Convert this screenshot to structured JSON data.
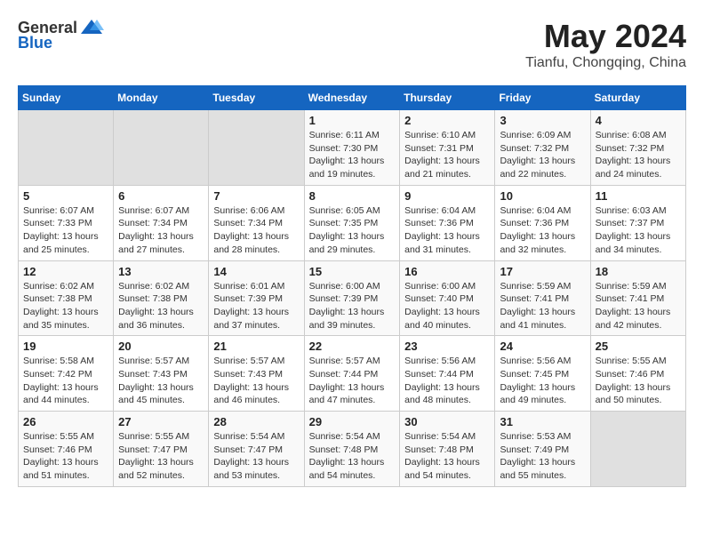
{
  "logo": {
    "general": "General",
    "blue": "Blue"
  },
  "title": "May 2024",
  "subtitle": "Tianfu, Chongqing, China",
  "headers": [
    "Sunday",
    "Monday",
    "Tuesday",
    "Wednesday",
    "Thursday",
    "Friday",
    "Saturday"
  ],
  "weeks": [
    [
      {
        "day": "",
        "info": ""
      },
      {
        "day": "",
        "info": ""
      },
      {
        "day": "",
        "info": ""
      },
      {
        "day": "1",
        "info": "Sunrise: 6:11 AM\nSunset: 7:30 PM\nDaylight: 13 hours\nand 19 minutes."
      },
      {
        "day": "2",
        "info": "Sunrise: 6:10 AM\nSunset: 7:31 PM\nDaylight: 13 hours\nand 21 minutes."
      },
      {
        "day": "3",
        "info": "Sunrise: 6:09 AM\nSunset: 7:32 PM\nDaylight: 13 hours\nand 22 minutes."
      },
      {
        "day": "4",
        "info": "Sunrise: 6:08 AM\nSunset: 7:32 PM\nDaylight: 13 hours\nand 24 minutes."
      }
    ],
    [
      {
        "day": "5",
        "info": "Sunrise: 6:07 AM\nSunset: 7:33 PM\nDaylight: 13 hours\nand 25 minutes."
      },
      {
        "day": "6",
        "info": "Sunrise: 6:07 AM\nSunset: 7:34 PM\nDaylight: 13 hours\nand 27 minutes."
      },
      {
        "day": "7",
        "info": "Sunrise: 6:06 AM\nSunset: 7:34 PM\nDaylight: 13 hours\nand 28 minutes."
      },
      {
        "day": "8",
        "info": "Sunrise: 6:05 AM\nSunset: 7:35 PM\nDaylight: 13 hours\nand 29 minutes."
      },
      {
        "day": "9",
        "info": "Sunrise: 6:04 AM\nSunset: 7:36 PM\nDaylight: 13 hours\nand 31 minutes."
      },
      {
        "day": "10",
        "info": "Sunrise: 6:04 AM\nSunset: 7:36 PM\nDaylight: 13 hours\nand 32 minutes."
      },
      {
        "day": "11",
        "info": "Sunrise: 6:03 AM\nSunset: 7:37 PM\nDaylight: 13 hours\nand 34 minutes."
      }
    ],
    [
      {
        "day": "12",
        "info": "Sunrise: 6:02 AM\nSunset: 7:38 PM\nDaylight: 13 hours\nand 35 minutes."
      },
      {
        "day": "13",
        "info": "Sunrise: 6:02 AM\nSunset: 7:38 PM\nDaylight: 13 hours\nand 36 minutes."
      },
      {
        "day": "14",
        "info": "Sunrise: 6:01 AM\nSunset: 7:39 PM\nDaylight: 13 hours\nand 37 minutes."
      },
      {
        "day": "15",
        "info": "Sunrise: 6:00 AM\nSunset: 7:39 PM\nDaylight: 13 hours\nand 39 minutes."
      },
      {
        "day": "16",
        "info": "Sunrise: 6:00 AM\nSunset: 7:40 PM\nDaylight: 13 hours\nand 40 minutes."
      },
      {
        "day": "17",
        "info": "Sunrise: 5:59 AM\nSunset: 7:41 PM\nDaylight: 13 hours\nand 41 minutes."
      },
      {
        "day": "18",
        "info": "Sunrise: 5:59 AM\nSunset: 7:41 PM\nDaylight: 13 hours\nand 42 minutes."
      }
    ],
    [
      {
        "day": "19",
        "info": "Sunrise: 5:58 AM\nSunset: 7:42 PM\nDaylight: 13 hours\nand 44 minutes."
      },
      {
        "day": "20",
        "info": "Sunrise: 5:57 AM\nSunset: 7:43 PM\nDaylight: 13 hours\nand 45 minutes."
      },
      {
        "day": "21",
        "info": "Sunrise: 5:57 AM\nSunset: 7:43 PM\nDaylight: 13 hours\nand 46 minutes."
      },
      {
        "day": "22",
        "info": "Sunrise: 5:57 AM\nSunset: 7:44 PM\nDaylight: 13 hours\nand 47 minutes."
      },
      {
        "day": "23",
        "info": "Sunrise: 5:56 AM\nSunset: 7:44 PM\nDaylight: 13 hours\nand 48 minutes."
      },
      {
        "day": "24",
        "info": "Sunrise: 5:56 AM\nSunset: 7:45 PM\nDaylight: 13 hours\nand 49 minutes."
      },
      {
        "day": "25",
        "info": "Sunrise: 5:55 AM\nSunset: 7:46 PM\nDaylight: 13 hours\nand 50 minutes."
      }
    ],
    [
      {
        "day": "26",
        "info": "Sunrise: 5:55 AM\nSunset: 7:46 PM\nDaylight: 13 hours\nand 51 minutes."
      },
      {
        "day": "27",
        "info": "Sunrise: 5:55 AM\nSunset: 7:47 PM\nDaylight: 13 hours\nand 52 minutes."
      },
      {
        "day": "28",
        "info": "Sunrise: 5:54 AM\nSunset: 7:47 PM\nDaylight: 13 hours\nand 53 minutes."
      },
      {
        "day": "29",
        "info": "Sunrise: 5:54 AM\nSunset: 7:48 PM\nDaylight: 13 hours\nand 54 minutes."
      },
      {
        "day": "30",
        "info": "Sunrise: 5:54 AM\nSunset: 7:48 PM\nDaylight: 13 hours\nand 54 minutes."
      },
      {
        "day": "31",
        "info": "Sunrise: 5:53 AM\nSunset: 7:49 PM\nDaylight: 13 hours\nand 55 minutes."
      },
      {
        "day": "",
        "info": ""
      }
    ]
  ]
}
